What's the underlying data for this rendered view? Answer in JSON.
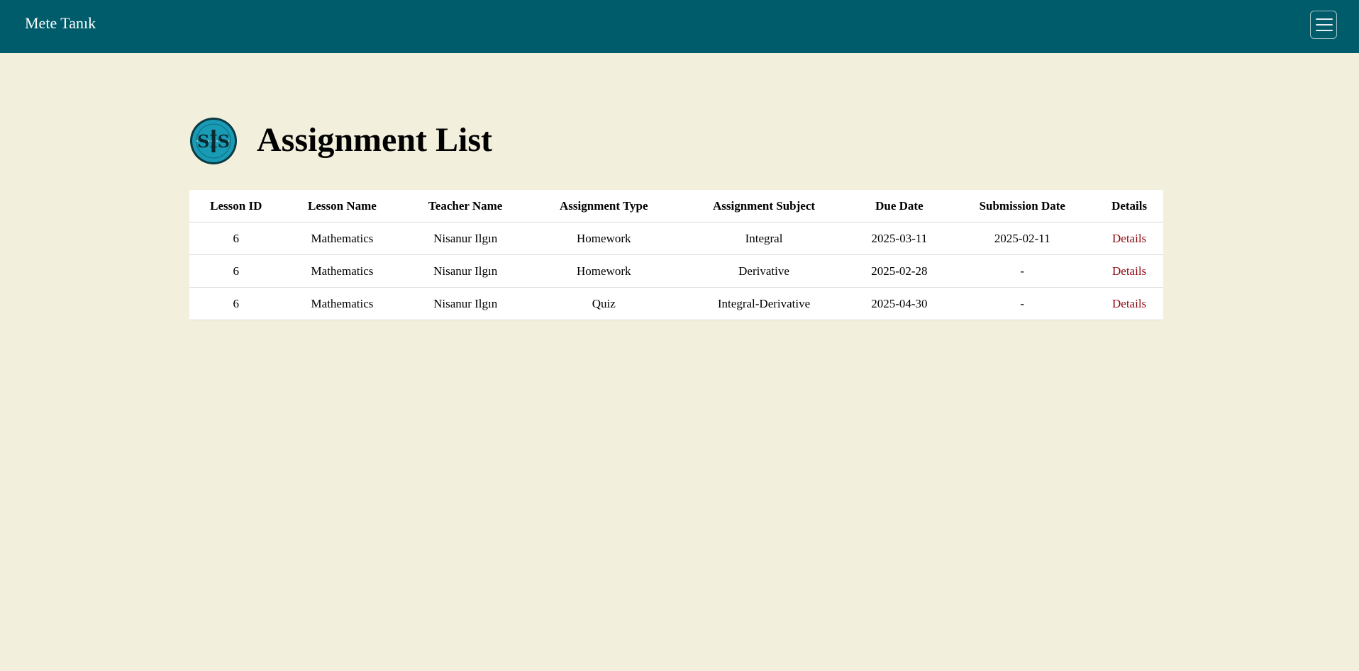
{
  "navbar": {
    "brand": "Mete Tanık"
  },
  "page": {
    "title": "Assignment List",
    "logo_text": "SIS"
  },
  "table": {
    "headers": [
      "Lesson ID",
      "Lesson Name",
      "Teacher Name",
      "Assignment Type",
      "Assignment Subject",
      "Due Date",
      "Submission Date",
      "Details"
    ],
    "rows": [
      [
        "6",
        "Mathematics",
        "Nisanur Ilgın",
        "Homework",
        "Integral",
        "2025-03-11",
        "2025-02-11",
        "Details"
      ],
      [
        "6",
        "Mathematics",
        "Nisanur Ilgın",
        "Homework",
        "Derivative",
        "2025-02-28",
        "-",
        "Details"
      ],
      [
        "6",
        "Mathematics",
        "Nisanur Ilgın",
        "Quiz",
        "Integral-Derivative",
        "2025-04-30",
        "-",
        "Details"
      ]
    ]
  },
  "colors": {
    "navbar_bg": "#005b6b",
    "page_bg": "#f2efdc",
    "link": "#8b0a14",
    "logo_fill": "#1a9bb5"
  },
  "icons": {
    "menu": "hamburger-icon",
    "logo": "sis-logo"
  }
}
